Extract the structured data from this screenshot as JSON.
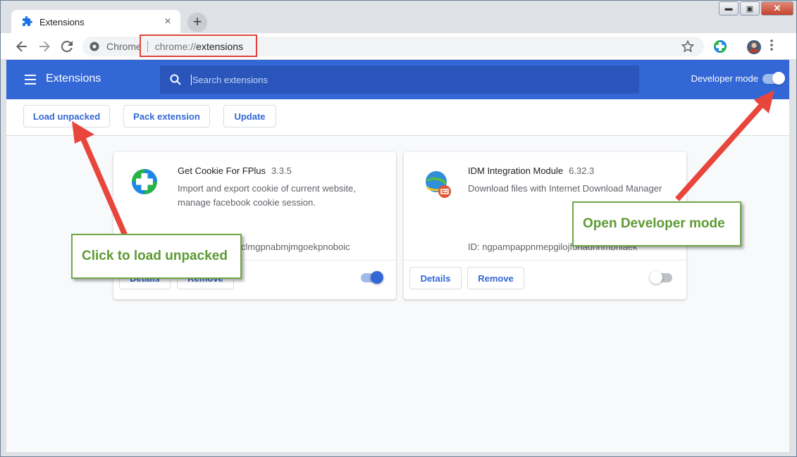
{
  "browser": {
    "tab_title": "Extensions",
    "tab_close": "×",
    "new_tab": "+",
    "omnibox_chip": "Chrome",
    "url_scheme": "chrome://",
    "url_path": "extensions",
    "window_controls": {
      "minimize": "▬",
      "maximize": "▣",
      "close": "✕"
    }
  },
  "header": {
    "title": "Extensions",
    "search_placeholder": "Search extensions",
    "developer_mode_label": "Developer mode",
    "developer_mode_on": true
  },
  "dev_toolbar": {
    "load_unpacked": "Load unpacked",
    "pack_extension": "Pack extension",
    "update": "Update"
  },
  "extensions": [
    {
      "name": "Get Cookie For FPlus",
      "version": "3.3.5",
      "description": "Import and export cookie of current website, manage facebook cookie session.",
      "id_text": "clmgpnabmjmgoekpnoboic",
      "details": "Details",
      "remove": "Remove",
      "enabled": true
    },
    {
      "name": "IDM Integration Module",
      "version": "6.32.3",
      "description": "Download files with Internet Download Manager",
      "id_text": "ID: ngpampappnmepgilojfohadhhmbhlaek",
      "details": "Details",
      "remove": "Remove",
      "enabled": false
    }
  ],
  "annotations": {
    "load_unpacked_callout": "Click to load unpacked",
    "developer_mode_callout": "Open Developer mode"
  },
  "colors": {
    "header_blue": "#3367d6",
    "annotation_red": "#e0433a",
    "callout_green": "#5d9a34"
  }
}
